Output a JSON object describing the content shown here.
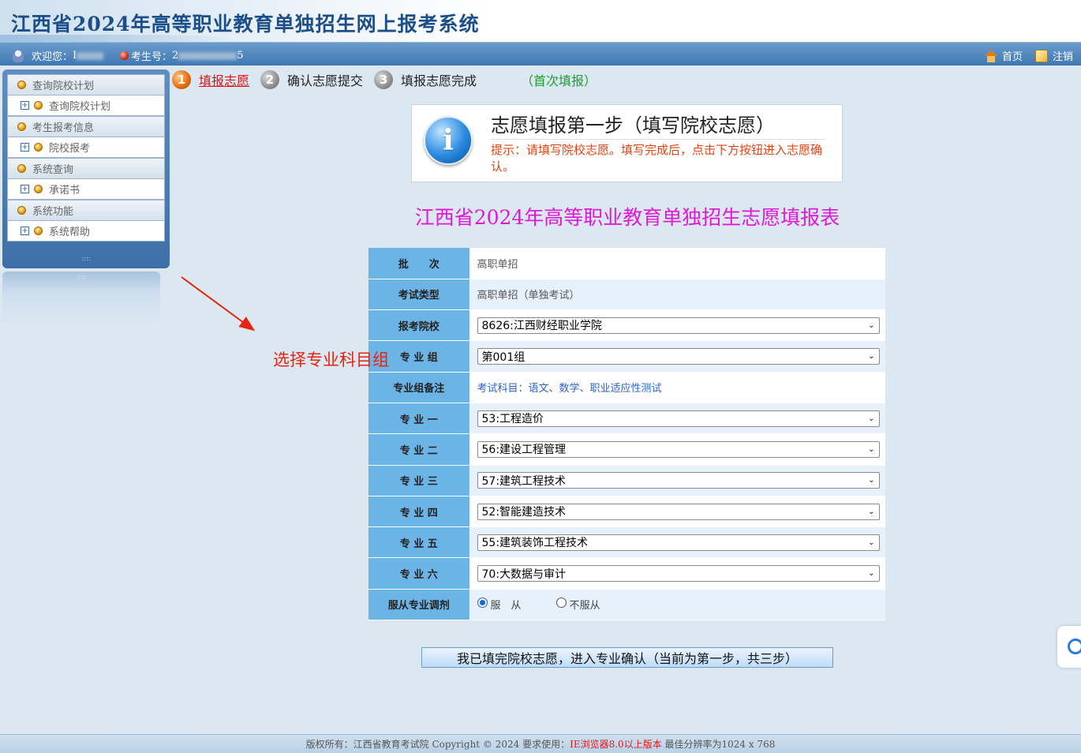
{
  "header": {
    "title": "江西省2024年高等职业教育单独招生网上报考系统"
  },
  "infobar": {
    "welcome_label": "欢迎您：",
    "welcome_name": "I",
    "candidate_label": "考生号：",
    "candidate_no": "2",
    "candidate_tail": "5",
    "home_label": "首页",
    "logout_label": "注销"
  },
  "sidebar": {
    "sections": [
      {
        "title": "查询院校计划",
        "items": [
          "查询院校计划"
        ]
      },
      {
        "title": "考生报考信息",
        "items": [
          "院校报考"
        ]
      },
      {
        "title": "系统查询",
        "items": [
          "承诺书"
        ]
      },
      {
        "title": "系统功能",
        "items": [
          "系统帮助"
        ]
      }
    ],
    "grip": "::::"
  },
  "steps": {
    "items": [
      {
        "num": "1",
        "label": "填报志愿"
      },
      {
        "num": "2",
        "label": "确认志愿提交"
      },
      {
        "num": "3",
        "label": "填报志愿完成"
      }
    ],
    "note": "（首次填报）"
  },
  "notice": {
    "title": "志愿填报第一步（填写院校志愿）",
    "text": "提示：请填写院校志愿。填写完成后，点击下方按钮进入志愿确认。"
  },
  "form": {
    "title": "江西省2024年高等职业教育单独招生志愿填报表",
    "rows": [
      {
        "label": "批　　次",
        "value": "高职单招"
      },
      {
        "label": "考试类型",
        "value": "高职单招（单独考试）"
      },
      {
        "label": "报考院校",
        "value": "8626:江西财经职业学院"
      },
      {
        "label": "专 业 组",
        "value": "第001组"
      },
      {
        "label": "专业组备注",
        "value": "考试科目：语文、数学、职业适应性测试"
      },
      {
        "label": "专 业 一",
        "value": "53:工程造价"
      },
      {
        "label": "专 业 二",
        "value": "56:建设工程管理"
      },
      {
        "label": "专 业 三",
        "value": "57:建筑工程技术"
      },
      {
        "label": "专 业 四",
        "value": "52:智能建造技术"
      },
      {
        "label": "专 业 五",
        "value": "55:建筑装饰工程技术"
      },
      {
        "label": "专 业 六",
        "value": "70:大数据与审计"
      },
      {
        "label": "服从专业调剂",
        "value": ""
      }
    ],
    "obey_label": "服　从",
    "not_obey_label": "不服从",
    "obey_selected": true
  },
  "annotation": {
    "text": "选择专业科目组",
    "color": "#e8230f"
  },
  "submit": {
    "label": "我已填完院校志愿，进入专业确认（当前为第一步，共三步）"
  },
  "footer": {
    "prefix": "版权所有：江西省教育考试院 Copyright © 2024 要求使用：",
    "warn": "IE浏览器8.0以上版本",
    "suffix": " 最佳分辨率为1024 x 768"
  }
}
